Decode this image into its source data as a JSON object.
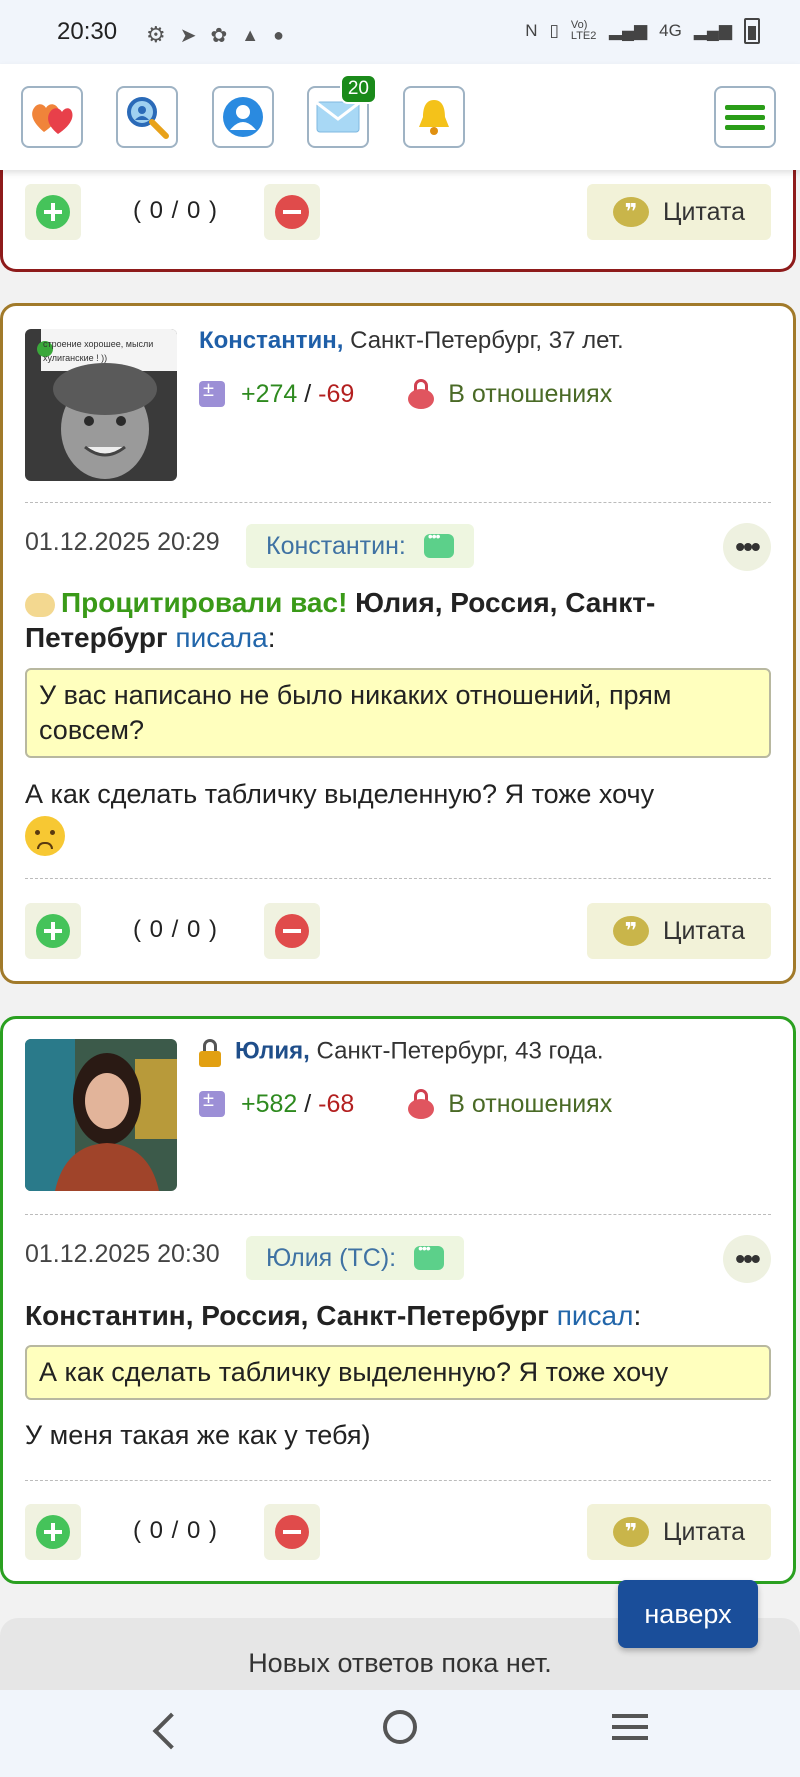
{
  "status_bar": {
    "time": "20:30",
    "network": "4G",
    "icons_left": [
      "gear-icon",
      "telegram-icon",
      "app-icon",
      "warning-icon",
      "dot-icon"
    ],
    "icons_right": [
      "nfc-icon",
      "vibrate-icon",
      "volte-icon",
      "signal-icon",
      "battery-icon"
    ],
    "volte_label": "Vo) LTE2"
  },
  "toolbar": {
    "buttons": [
      "hearts-icon",
      "search-icon",
      "profile-icon",
      "mail-icon",
      "bell-icon"
    ],
    "mail_badge": "20",
    "menu_icon": "hamburger-icon"
  },
  "prev_post": {
    "vote_count": "( 0 / 0 )",
    "quote_label": "Цитата"
  },
  "post1": {
    "avatar_caption": "строение хорошее, мысли хулиганские ! ))",
    "user_name": "Константин,",
    "user_info": " Санкт-Петербург, 37 лет.",
    "karma_plus": "+274",
    "karma_sep": " / ",
    "karma_minus": "-69",
    "relationship": "В отношениях",
    "date": "01.12.2025 20:29",
    "author_chip": "Константин:",
    "ref_alert": "Процитировали вас!",
    "ref_user": " Юлия, Россия, Санкт-Петербург",
    "ref_verb": "писала",
    "ref_colon": ":",
    "quote_text": "У вас написано не было никаких отношений, прям совсем?",
    "message_text": "А как сделать табличку выделенную? Я тоже хочу",
    "vote_count": "( 0 / 0 )",
    "quote_label": "Цитата"
  },
  "post2": {
    "user_name": "Юлия,",
    "user_info": " Санкт-Петербург, 43 года.",
    "karma_plus": "+582",
    "karma_sep": " / ",
    "karma_minus": "-68",
    "relationship": "В отношениях",
    "date": "01.12.2025 20:30",
    "author_chip": "Юлия (ТС):",
    "ref_user": "Константин, Россия, Санкт-Петербург",
    "ref_verb": "писал",
    "ref_colon": ":",
    "quote_text": "А как сделать табличку выделенную? Я тоже хочу",
    "message_text": "У меня такая же как у тебя)",
    "vote_count": "( 0 / 0 )",
    "quote_label": "Цитата"
  },
  "footer": {
    "no_replies": "Новых ответов пока нет.",
    "top_button": "наверх"
  },
  "colors": {
    "accent_blue": "#1f5fa8",
    "plus_green": "#2e8a1f",
    "minus_red": "#b31f1f",
    "post1_border": "#a17a2a",
    "post2_border": "#2aa020",
    "prev_border": "#8e1b1b"
  }
}
